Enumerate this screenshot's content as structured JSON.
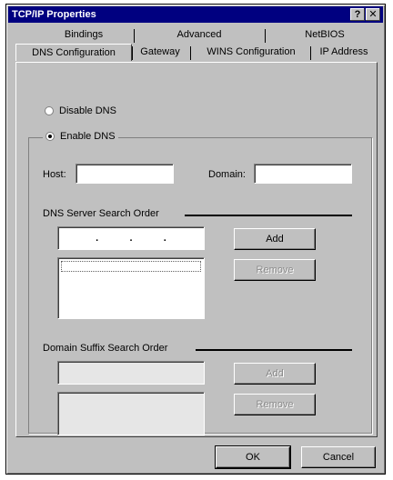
{
  "window": {
    "title": "TCP/IP Properties",
    "help_glyph": "?",
    "close_glyph": "✕"
  },
  "tabs": {
    "row1": [
      "Bindings",
      "Advanced",
      "NetBIOS"
    ],
    "row2": [
      "DNS Configuration",
      "Gateway",
      "WINS Configuration",
      "IP Address"
    ],
    "active": "DNS Configuration"
  },
  "dns": {
    "disable_label": "Disable DNS",
    "enable_label": "Enable DNS",
    "selected": "Enable DNS",
    "host_label": "Host:",
    "host_value": "",
    "domain_label": "Domain:",
    "domain_value": ""
  },
  "server_order": {
    "title": "DNS Server Search Order",
    "ip_dots": [
      ".",
      ".",
      "."
    ],
    "add_label": "Add",
    "remove_label": "Remove"
  },
  "suffix_order": {
    "title": "Domain Suffix Search Order",
    "add_label": "Add",
    "remove_label": "Remove"
  },
  "footer": {
    "ok_label": "OK",
    "cancel_label": "Cancel"
  }
}
